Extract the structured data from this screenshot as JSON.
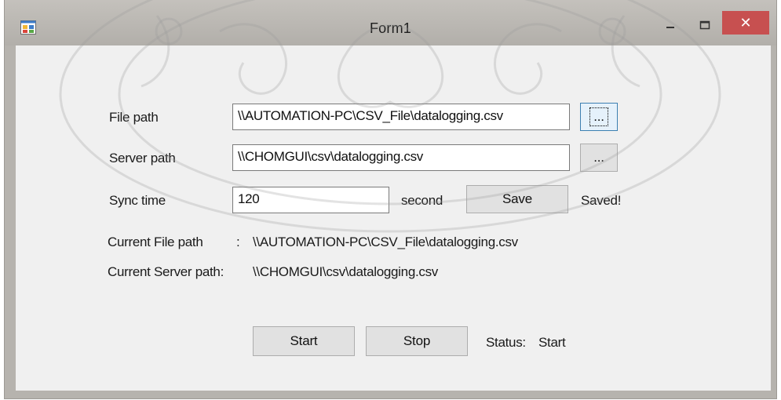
{
  "window": {
    "title": "Form1",
    "icon": "app-form-icon",
    "close_glyph": "✕",
    "accent_close": "#c75050"
  },
  "form": {
    "file_path_label": "File path",
    "file_path_value": "\\\\AUTOMATION-PC\\CSV_File\\datalogging.csv",
    "file_browse_label": "...",
    "server_path_label": "Server path",
    "server_path_value": "\\\\CHOMGUI\\csv\\datalogging.csv",
    "server_browse_label": "...",
    "sync_time_label": "Sync time",
    "sync_time_value": "120",
    "sync_unit_label": "second",
    "save_label": "Save",
    "saved_status": "Saved!",
    "current_file_path_label": "Current File path",
    "current_file_path_sep": ":",
    "current_file_path_value": "\\\\AUTOMATION-PC\\CSV_File\\datalogging.csv",
    "current_server_path_label": "Current Server path:",
    "current_server_path_value": "\\\\CHOMGUI\\csv\\datalogging.csv",
    "start_label": "Start",
    "stop_label": "Stop",
    "status_label": "Status:",
    "status_value": "Start"
  }
}
